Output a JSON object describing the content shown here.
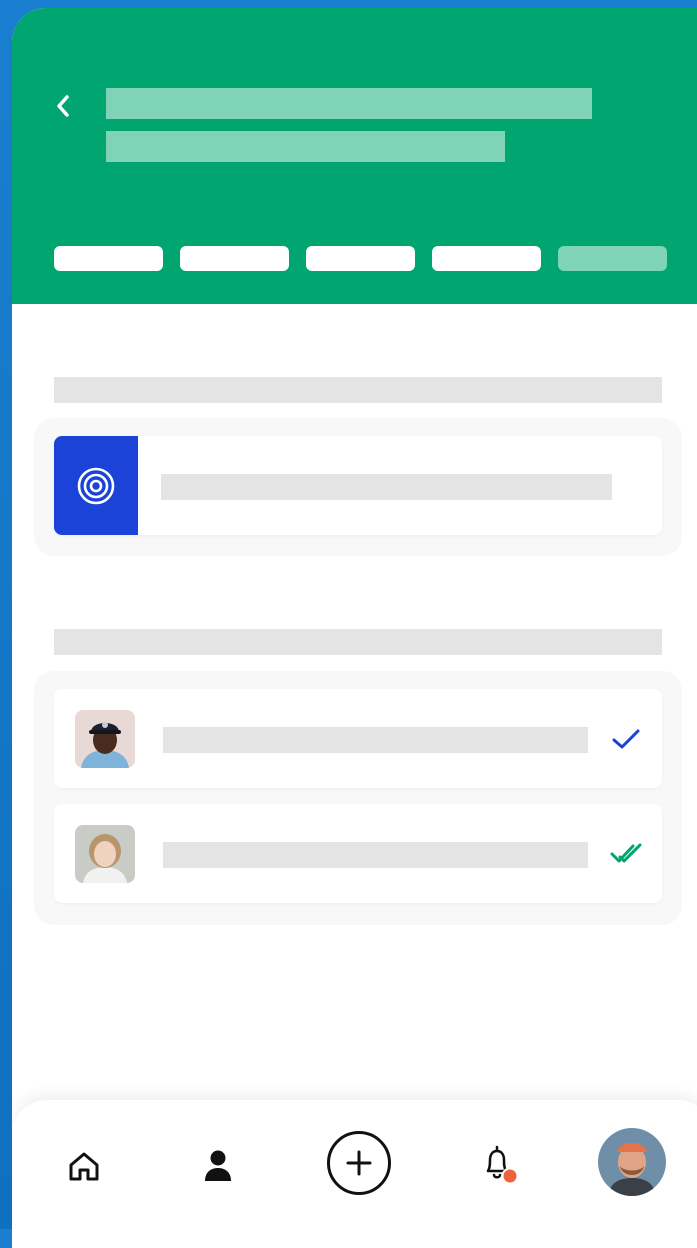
{
  "header": {
    "back_icon": "chevron-left-icon",
    "title_lines": 2,
    "steps_total": 5,
    "steps_completed": 4
  },
  "sections": [
    {
      "id": "target",
      "items": [
        {
          "icon": "target-icon",
          "icon_bg": "#1b43d8"
        }
      ]
    },
    {
      "id": "people",
      "items": [
        {
          "avatar": "avatar-man-cap",
          "status_icon": "single-check-icon",
          "status_color": "#1b43d8"
        },
        {
          "avatar": "avatar-woman",
          "status_icon": "double-check-icon",
          "status_color": "#01a56f"
        }
      ]
    }
  ],
  "colors": {
    "brand": "#01a56f",
    "accent_blue": "#1b43d8",
    "notification_dot": "#f0633a",
    "placeholder": "#e4e4e4"
  },
  "bottom_nav": {
    "items": [
      "home-icon",
      "profile-icon",
      "add-icon",
      "notification-bell-icon",
      "user-avatar"
    ],
    "has_notification": true
  }
}
